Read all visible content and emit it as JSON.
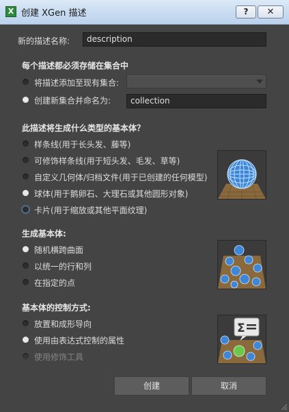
{
  "window": {
    "title": "创建 XGen 描述",
    "app_icon_letter": "X",
    "help_label": "?",
    "close_label": "✕"
  },
  "name_row": {
    "label": "新的描述名称:",
    "value": "description"
  },
  "collection_section": {
    "title": "每个描述都必须存储在集合中",
    "add_existing_label": "将描述添加至现有集合:",
    "add_existing_value": "",
    "create_new_label": "创建新集合并命名为:",
    "create_new_value": "collection",
    "selected": "create_new"
  },
  "primitive_type_section": {
    "title": "此描述将生成什么类型的基本体？",
    "options": [
      "样条线(用于长头发、藤等)",
      "可修饰样条线(用于短头发、毛发、草等)",
      "自定义几何体/归档文件(用于已创建的任何模型)",
      "球体(用于鹅卵石、大理石或其他圆形对象)",
      "卡片(用于缩放或其他平面纹理)"
    ],
    "selected_index": 3,
    "focused_index": 4,
    "thumbnail_icon": "sphere-primitive-icon"
  },
  "generate_section": {
    "title": "生成基本体:",
    "options": [
      "随机横跨曲面",
      "以统一的行和列",
      "在指定的点"
    ],
    "selected_index": 0,
    "thumbnail_icon": "random-spheres-icon"
  },
  "control_section": {
    "title": "基本体的控制方式:",
    "options": [
      "放置和成形导向",
      "使用由表达式控制的属性",
      "使用修饰工具"
    ],
    "selected_index": 1,
    "disabled_index": 2,
    "thumbnail_icon": "expression-spheres-icon"
  },
  "buttons": {
    "create": "创建",
    "cancel": "取消"
  },
  "colors": {
    "background": "#444444",
    "sphere_blue": "#4a90d9",
    "sphere_green": "#6cc84a"
  }
}
